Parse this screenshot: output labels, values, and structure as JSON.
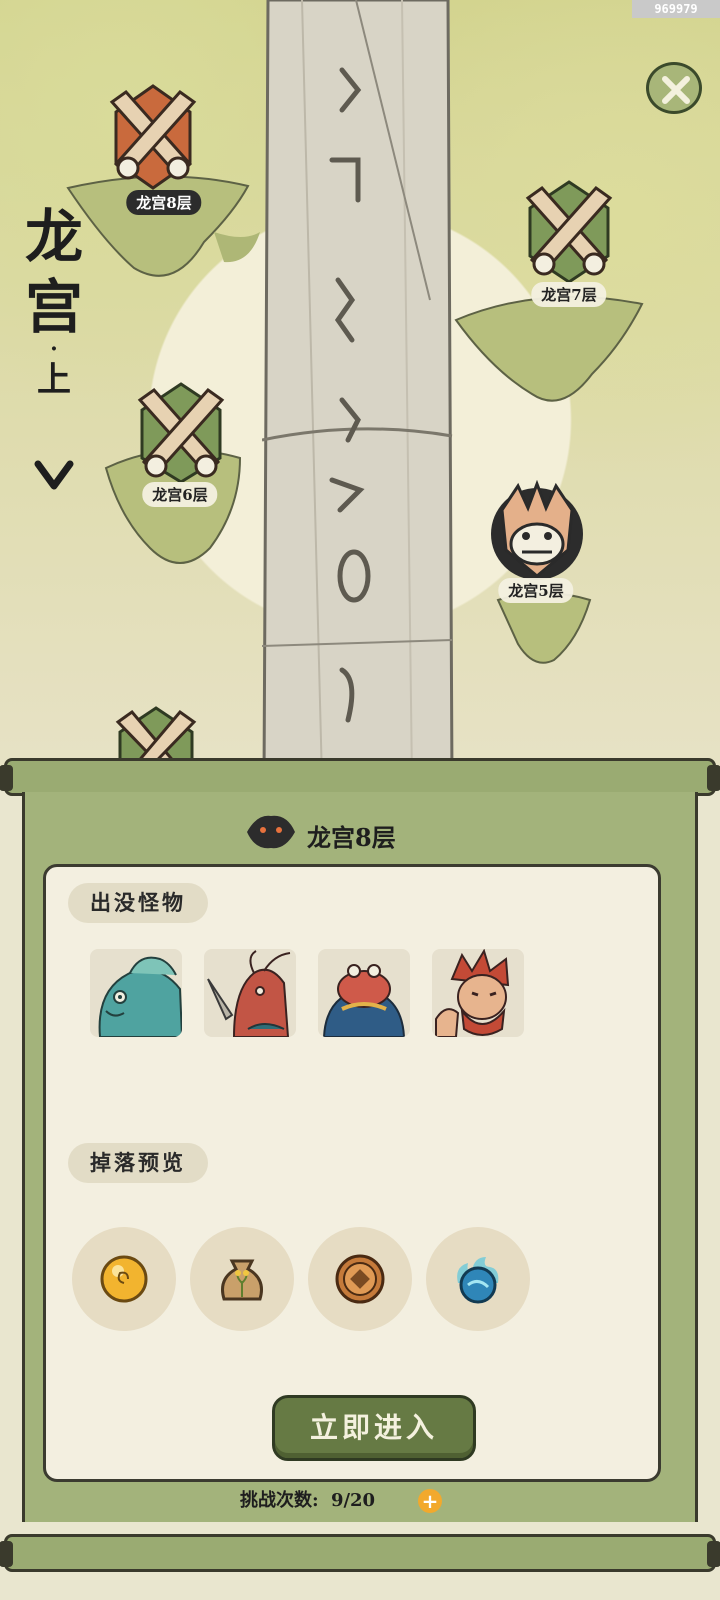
{
  "watermark": "969979",
  "title": {
    "main_1": "龙",
    "main_2": "宫",
    "dot": "·",
    "sub": "上"
  },
  "levels": [
    {
      "label": "龙宫8层",
      "icon": "crossed-swords-icon",
      "state": "current"
    },
    {
      "label": "龙宫7层",
      "icon": "crossed-swords-icon",
      "state": "normal"
    },
    {
      "label": "龙宫6层",
      "icon": "crossed-swords-icon",
      "state": "normal"
    },
    {
      "label": "龙宫5层",
      "icon": "dragon-boss-icon",
      "state": "boss"
    }
  ],
  "panel": {
    "title": "龙宫8层",
    "monsters_label": "出没怪物",
    "monsters": [
      "fish-monster",
      "shrimp-soldier",
      "crab-general",
      "red-haired-ogre"
    ],
    "drops_label": "掉落预览",
    "drops": [
      "gold-orb-icon",
      "seed-bag-icon",
      "copper-coin-icon",
      "spirit-flame-orb-icon"
    ],
    "enter_button": "立即进入",
    "attempts_label": "挑战次数:",
    "attempts_value": "9/20",
    "plus_label": "+"
  },
  "colors": {
    "panel_green": "#a3b37b",
    "button_green": "#667a44",
    "current_badge": "#c96a3d",
    "normal_badge": "#7f9a5a"
  }
}
